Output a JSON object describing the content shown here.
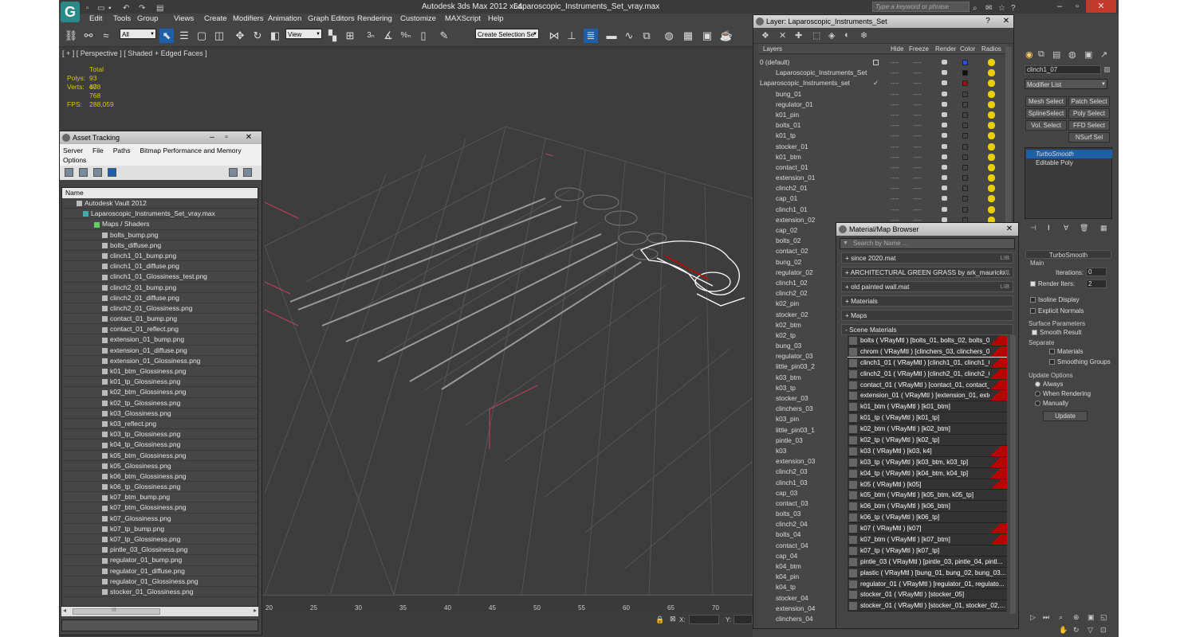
{
  "app": {
    "title": "Autodesk 3ds Max  2012 x64",
    "filename": "Laparoscopic_Instruments_Set_vray.max",
    "search_placeholder": "Type a keyword or phrase",
    "logo": "G"
  },
  "menu": [
    "Edit",
    "Tools",
    "Group",
    "Views",
    "Create",
    "Modifiers",
    "Animation",
    "Graph Editors",
    "Rendering",
    "Customize",
    "MAXScript",
    "Help"
  ],
  "toolbar": {
    "filter": "All",
    "refcoord": "View",
    "selset": "Create Selection Se"
  },
  "viewport": {
    "label": "[ + ] [ Perspective ] [ Shaded + Edged Faces ]",
    "stats": {
      "total_label": "Total",
      "polys_label": "Polys:",
      "polys": "93 608",
      "verts_label": "Verts:",
      "verts": "47 768",
      "fps_label": "FPS:",
      "fps": "288,059"
    }
  },
  "timeline": {
    "ticks": [
      "20",
      "25",
      "30",
      "35",
      "40",
      "45",
      "50",
      "55",
      "60",
      "65",
      "70"
    ]
  },
  "status": {
    "x_label": "X:",
    "y_label": "Y:"
  },
  "asset_tracking": {
    "title": "Asset Tracking",
    "menu": [
      "Server",
      "File",
      "Paths",
      "Bitmap Performance and Memory",
      "Options"
    ],
    "column": "Name",
    "vault": "Autodesk Vault 2012",
    "file": "Laparoscopic_Instruments_Set_vray.max",
    "folder": "Maps / Shaders",
    "items": [
      "bolts_bump.png",
      "bolts_diffuse.png",
      "clinch1_01_bump.png",
      "clinch1_01_diffuse.png",
      "clinch1_01_Glossiness_test.png",
      "clinch2_01_bump.png",
      "clinch2_01_diffuse.png",
      "clinch2_01_Glossiness.png",
      "contact_01_bump.png",
      "contact_01_reflect.png",
      "extension_01_bump.png",
      "extension_01_diffuse.png",
      "extension_01_Glossiness.png",
      "k01_btm_Glossiness.png",
      "k01_tp_Glossiness.png",
      "k02_btm_Glossiness.png",
      "k02_tp_Glossiness.png",
      "k03_Glossiness.png",
      "k03_reflect.png",
      "k03_tp_Glossiness.png",
      "k04_tp_Glossiness.png",
      "k05_btm_Glossiness.png",
      "k05_Glossiness.png",
      "k06_btm_Glossiness.png",
      "k06_tp_Glossiness.png",
      "k07_btm_bump.png",
      "k07_btm_Glossiness.png",
      "k07_Glossiness.png",
      "k07_tp_bump.png",
      "k07_tp_Glossiness.png",
      "pintle_03_Glossiness.png",
      "regulator_01_bump.png",
      "regulator_01_diffuse.png",
      "regulator_01_Glossiness.png",
      "stocker_01_Glossiness.png"
    ],
    "scroll_glyph": "III"
  },
  "layer": {
    "title": "Layer: Laparoscopic_Instruments_Set",
    "cols": {
      "layers": "Layers",
      "hide": "Hide",
      "freeze": "Freeze",
      "render": "Render",
      "color": "Color",
      "radios": "Radios"
    },
    "rows": [
      "0 (default)",
      "Laparoscopic_Instruments_Set",
      "Laparoscopic_Instruments_set",
      "bung_01",
      "regulator_01",
      "k01_pin",
      "bolts_01",
      "k01_tp",
      "stocker_01",
      "k01_btm",
      "contact_01",
      "extension_01",
      "clinch2_01",
      "cap_01",
      "clinch1_01",
      "extension_02",
      "cap_02",
      "bolts_02",
      "contact_02",
      "bung_02",
      "regulator_02",
      "clinch1_02",
      "clinch2_02",
      "k02_pin",
      "stocker_02",
      "k02_btm",
      "k02_tp",
      "bung_03",
      "regulator_03",
      "little_pin03_2",
      "k03_btm",
      "k03_tp",
      "stocker_03",
      "clinchers_03",
      "k03_pin",
      "little_pin03_1",
      "pintle_03",
      "k03",
      "extension_03",
      "clinch2_03",
      "clinch1_03",
      "cap_03",
      "contact_03",
      "bolts_03",
      "clinch2_04",
      "bolts_04",
      "contact_04",
      "cap_04",
      "k04_btm",
      "k04_pin",
      "k04_tp",
      "stocker_04",
      "extension_04",
      "clinchers_04"
    ],
    "dash": "----",
    "check": "✓"
  },
  "material": {
    "title": "Material/Map Browser",
    "search": "Search by Name ...",
    "groups": [
      {
        "label": "+ since 2020.mat",
        "lib": "LIB"
      },
      {
        "label": "+ ARCHITECTURAL GREEN GRASS by ark_mauricio...",
        "lib": "LIB"
      },
      {
        "label": "+ old painted wall.mat",
        "lib": "LIB"
      },
      {
        "label": "+ Materials",
        "lib": ""
      },
      {
        "label": "+ Maps",
        "lib": ""
      },
      {
        "label": "- Scene Materials",
        "lib": ""
      }
    ],
    "items": [
      "bolts  ( VRayMtl )  [bolts_01, bolts_02, bolts_03, b...",
      "chrom  ( VRayMtl )  [clinchers_03, clinchers_04, cl...",
      "clinch1_01  ( VRayMtl )  [clinch1_01, clinch1_02, c...",
      "clinch2_01  ( VRayMtl )  [clinch2_01, clinch2_02, c...",
      "contact_01  ( VRayMtl )  [contact_01, contact_02,...",
      "extension_01  ( VRayMtl )  [extension_01, extensi...",
      "k01_btm  ( VRayMtl )  [k01_btm]",
      "k01_tp  ( VRayMtl )  [k01_tp]",
      "k02_btm  ( VRayMtl )  [k02_btm]",
      "k02_tp  ( VRayMtl )  [k02_tp]",
      "k03  ( VRayMtl )  [k03, k4]",
      "k03_tp  ( VRayMtl )  [k03_btm, k03_tp]",
      "k04_tp  ( VRayMtl )  [k04_btm, k04_tp]",
      "k05  ( VRayMtl )  [k05]",
      "k05_btm  ( VRayMtl )  [k05_btm, k05_tp]",
      "k06_btm  ( VRayMtl )  [k06_btm]",
      "k06_tp  ( VRayMtl )  [k06_tp]",
      "k07  ( VRayMtl )  [k07]",
      "k07_btm  ( VRayMtl )  [k07_btm]",
      "k07_tp  ( VRayMtl )  [k07_tp]",
      "pintle_03  ( VRayMtl )  [pintle_03, pintle_04, pintl...",
      "plastic  ( VRayMtl )  [bung_01, bung_02, bung_03...",
      "regulator_01  ( VRayMtl )  [regulator_01, regulato...",
      "stocker_01  ( VRayMtl )  [stocker_05]",
      "stocker_01  ( VRayMtl )  [stocker_01, stocker_02,..."
    ]
  },
  "command": {
    "object_name": "clinch1_07",
    "modifier_list": "Modifier List",
    "buttons": [
      "Mesh Select",
      "Patch Select",
      "SplineSelect",
      "Poly Select",
      "Vol. Select",
      "FFD Select",
      "NSurf Sel"
    ],
    "stack": [
      "TurboSmooth",
      "Editable Poly"
    ],
    "turbosmooth": {
      "title": "TurboSmooth",
      "main": "Main",
      "iterations_label": "Iterations:",
      "iterations": "0",
      "render_iters_label": "Render Iters:",
      "render_iters": "2",
      "isoline": "Isoline Display",
      "explicit": "Explicit Normals",
      "surface": "Surface Parameters",
      "smooth": "Smooth Result",
      "separate": "Separate",
      "materials": "Materials",
      "smoothing": "Smoothing Groups",
      "update_options": "Update Options",
      "always": "Always",
      "when_rendering": "When Rendering",
      "manually": "Manually",
      "update": "Update"
    }
  },
  "colors": {
    "accent": "#1e5fa8",
    "selection_red": "#b00000",
    "wire": "#ffffff",
    "grid": "#5a5a5a"
  }
}
